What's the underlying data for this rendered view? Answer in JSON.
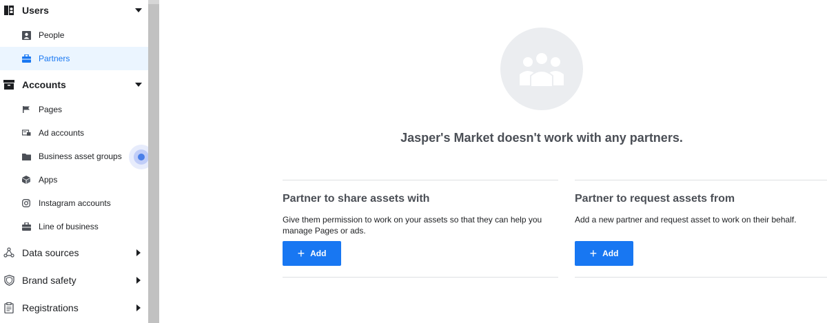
{
  "sidebar": {
    "users": {
      "label": "Users",
      "icon": "users-icon",
      "items": [
        {
          "label": "People",
          "icon": "person-icon"
        },
        {
          "label": "Partners",
          "icon": "briefcase-icon",
          "active": true
        }
      ]
    },
    "accounts": {
      "label": "Accounts",
      "icon": "archive-icon",
      "items": [
        {
          "label": "Pages",
          "icon": "flag-icon"
        },
        {
          "label": "Ad accounts",
          "icon": "ad-account-icon"
        },
        {
          "label": "Business asset groups",
          "icon": "folder-icon"
        },
        {
          "label": "Apps",
          "icon": "cube-icon"
        },
        {
          "label": "Instagram accounts",
          "icon": "instagram-icon"
        },
        {
          "label": "Line of business",
          "icon": "briefcase-icon"
        }
      ]
    },
    "data_sources": {
      "label": "Data sources",
      "icon": "data-sources-icon"
    },
    "brand_safety": {
      "label": "Brand safety",
      "icon": "shield-icon"
    },
    "registrations": {
      "label": "Registrations",
      "icon": "clipboard-icon"
    }
  },
  "main": {
    "empty_title": "Jasper's Market doesn't work with any partners.",
    "share_card": {
      "title": "Partner to share assets with",
      "desc": "Give them permission to work on your assets so that they can help you manage Pages or ads.",
      "button": "Add"
    },
    "request_card": {
      "title": "Partner to request assets from",
      "desc": "Add a new partner and request asset to work on their behalf.",
      "button": "Add"
    }
  },
  "colors": {
    "accent": "#1877f2",
    "active_bg": "#ebf5ff",
    "muted_title": "#4b4f56",
    "divider": "#dddfe2"
  }
}
